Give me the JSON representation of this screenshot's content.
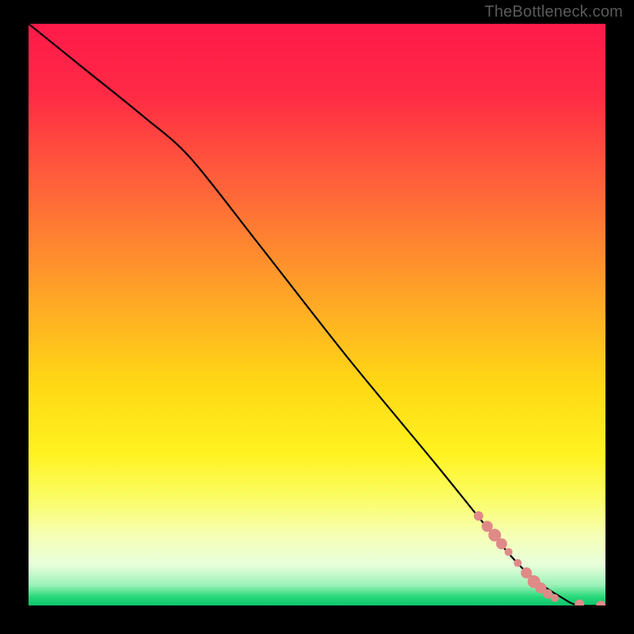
{
  "attribution": "TheBottleneck.com",
  "chart_data": {
    "type": "line",
    "title": "",
    "xlabel": "",
    "ylabel": "",
    "xlim": [
      0,
      100
    ],
    "ylim": [
      0,
      100
    ],
    "background_gradient": {
      "stops": [
        {
          "offset": 0.0,
          "color": "#ff1a4a"
        },
        {
          "offset": 0.12,
          "color": "#ff2a45"
        },
        {
          "offset": 0.3,
          "color": "#ff6a38"
        },
        {
          "offset": 0.5,
          "color": "#ffb023"
        },
        {
          "offset": 0.62,
          "color": "#ffd814"
        },
        {
          "offset": 0.74,
          "color": "#fff320"
        },
        {
          "offset": 0.82,
          "color": "#fbfd6a"
        },
        {
          "offset": 0.88,
          "color": "#f6ffb6"
        },
        {
          "offset": 0.93,
          "color": "#e8ffdc"
        },
        {
          "offset": 0.965,
          "color": "#9cf2b8"
        },
        {
          "offset": 0.985,
          "color": "#28d97a"
        },
        {
          "offset": 1.0,
          "color": "#0cc46a"
        }
      ]
    },
    "series": [
      {
        "name": "curve",
        "type": "line",
        "x": [
          0,
          10,
          20,
          28,
          40,
          55,
          70,
          85,
          93,
          96,
          100
        ],
        "y": [
          100,
          92,
          84,
          77,
          62,
          43,
          25,
          7,
          1,
          0,
          0
        ]
      },
      {
        "name": "markers",
        "type": "scatter",
        "marker_color": "#e08a88",
        "points": [
          {
            "x": 78.0,
            "y": 15.4,
            "r": 6
          },
          {
            "x": 79.5,
            "y": 13.6,
            "r": 7
          },
          {
            "x": 80.8,
            "y": 12.1,
            "r": 8
          },
          {
            "x": 82.0,
            "y": 10.6,
            "r": 7
          },
          {
            "x": 83.2,
            "y": 9.2,
            "r": 5
          },
          {
            "x": 84.8,
            "y": 7.3,
            "r": 5
          },
          {
            "x": 86.3,
            "y": 5.6,
            "r": 7
          },
          {
            "x": 87.6,
            "y": 4.1,
            "r": 8
          },
          {
            "x": 88.8,
            "y": 3.0,
            "r": 7
          },
          {
            "x": 90.0,
            "y": 2.0,
            "r": 6
          },
          {
            "x": 91.2,
            "y": 1.3,
            "r": 5
          },
          {
            "x": 95.5,
            "y": 0.2,
            "r": 6
          },
          {
            "x": 99.2,
            "y": 0.0,
            "r": 6
          }
        ]
      }
    ]
  }
}
